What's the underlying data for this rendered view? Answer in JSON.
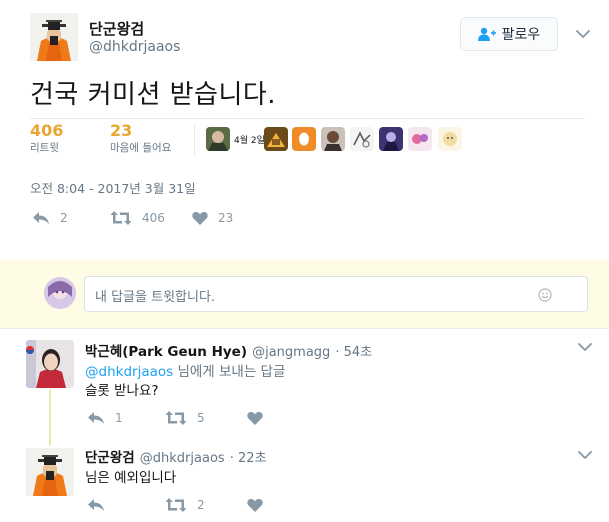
{
  "main_tweet": {
    "display_name": "단군왕검",
    "handle": "@dhkdrjaaos",
    "follow_label": "팔로우",
    "text": "건국 커미션 받습니다.",
    "retweets": {
      "count": "406",
      "label": "리트윗"
    },
    "likes": {
      "count": "23",
      "label": "마음에 들어요"
    },
    "date_badge": "4월 2일",
    "timestamp": "오전 8:04 - 2017년 3월 31일",
    "actions": {
      "reply": "2",
      "retweet": "406",
      "like": "23"
    }
  },
  "reply_box": {
    "placeholder": "내 답글을 트윗합니다."
  },
  "replies": [
    {
      "display_name": "박근혜(Park Geun Hye)",
      "handle": "@jangmagg",
      "time": "· 54초",
      "reply_to_handle": "@dhkdrjaaos",
      "reply_to_suffix": " 님에게 보내는 답글",
      "text": "슬롯 받나요?",
      "actions": {
        "reply": "1",
        "retweet": "5",
        "like": ""
      }
    },
    {
      "display_name": "단군왕검",
      "handle": "@dhkdrjaaos",
      "time": "· 22초",
      "text": "님은 예외입니다",
      "actions": {
        "reply": "",
        "retweet": "2",
        "like": ""
      }
    }
  ],
  "colors": {
    "accent": "#1da1f2",
    "stat": "#e8a633",
    "reply_bg": "#fffce6"
  },
  "icons": [
    "person-add-icon",
    "chevron-down-icon",
    "reply-icon",
    "retweet-icon",
    "heart-icon",
    "smiley-icon"
  ]
}
